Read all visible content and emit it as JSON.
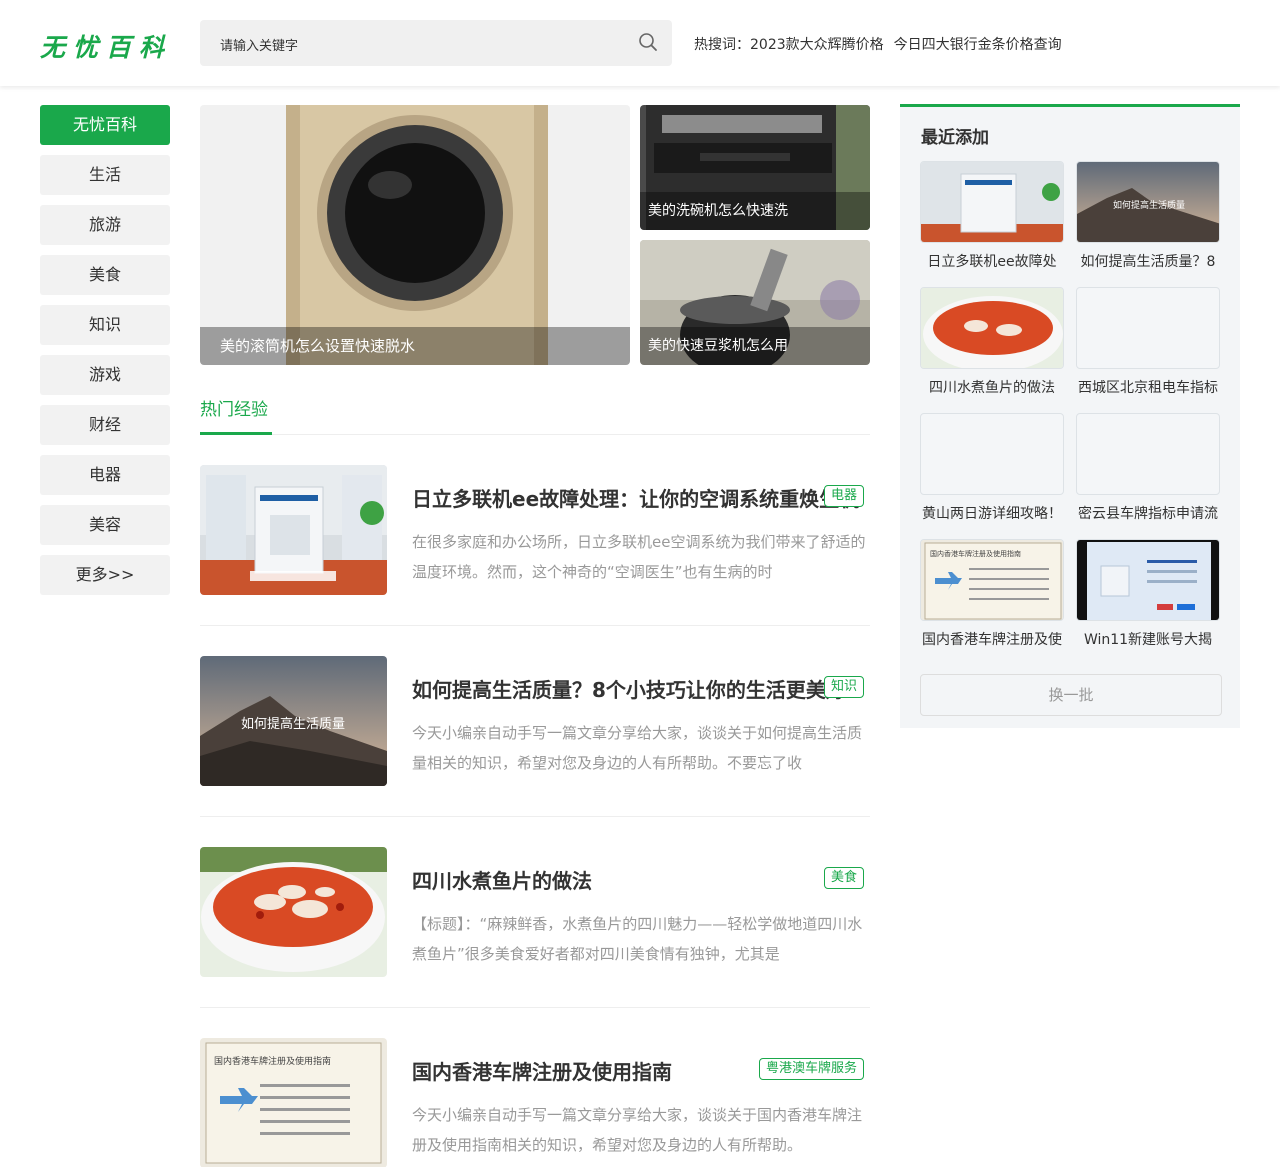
{
  "header": {
    "logo": "无忧百科",
    "search_placeholder": "请输入关键字",
    "hot_label": "热搜词：",
    "hot_words": [
      "2023款大众辉腾价格",
      "今日四大银行金条价格查询"
    ]
  },
  "nav": {
    "items": [
      "无忧百科",
      "生活",
      "旅游",
      "美食",
      "知识",
      "游戏",
      "财经",
      "电器",
      "美容",
      "更多>>"
    ]
  },
  "banner": {
    "main_caption": "美的滚筒机怎么设置快速脱水",
    "side": [
      {
        "caption": "美的洗碗机怎么快速洗"
      },
      {
        "caption": "美的快速豆浆机怎么用"
      }
    ]
  },
  "hot": {
    "title": "热门经验",
    "articles": [
      {
        "title": "日立多联机ee故障处理：让你的空调系统重焕生机",
        "tag": "电器",
        "desc": "在很多家庭和办公场所，日立多联机ee空调系统为我们带来了舒适的温度环境。然而，这个神奇的“空调医生”也有生病的时"
      },
      {
        "title": "如何提高生活质量？8个小技巧让你的生活更美好",
        "tag": "知识",
        "desc": "今天小编亲自动手写一篇文章分享给大家，谈谈关于如何提高生活质量相关的知识，希望对您及身边的人有所帮助。不要忘了收",
        "thumb_text": "如何提高生活质量"
      },
      {
        "title": "四川水煮鱼片的做法",
        "tag": "美食",
        "desc": "【标题】：“麻辣鲜香，水煮鱼片的四川魅力——轻松学做地道四川水煮鱼片”很多美食爱好者都对四川美食情有独钟，尤其是"
      },
      {
        "title": "国内香港车牌注册及使用指南",
        "tag": "粤港澳车牌服务",
        "desc": "今天小编亲自动手写一篇文章分享给大家，谈谈关于国内香港车牌注册及使用指南相关的知识，希望对您及身边的人有所帮助。",
        "thumb_text": "国内香港车牌注册及使用指南"
      }
    ]
  },
  "sidebar": {
    "title": "最近添加",
    "items": [
      {
        "label": "日立多联机ee故障处"
      },
      {
        "label": "如何提高生活质量？8",
        "thumb_text": "如何提高生活质量"
      },
      {
        "label": "四川水煮鱼片的做法"
      },
      {
        "label": "西城区北京租电车指标"
      },
      {
        "label": "黄山两日游详细攻略！"
      },
      {
        "label": "密云县车牌指标申请流"
      },
      {
        "label": "国内香港车牌注册及使",
        "thumb_text": "国内香港车牌注册及使用指南"
      },
      {
        "label": "Win11新建账号大揭"
      }
    ],
    "more_button": "换一批"
  }
}
